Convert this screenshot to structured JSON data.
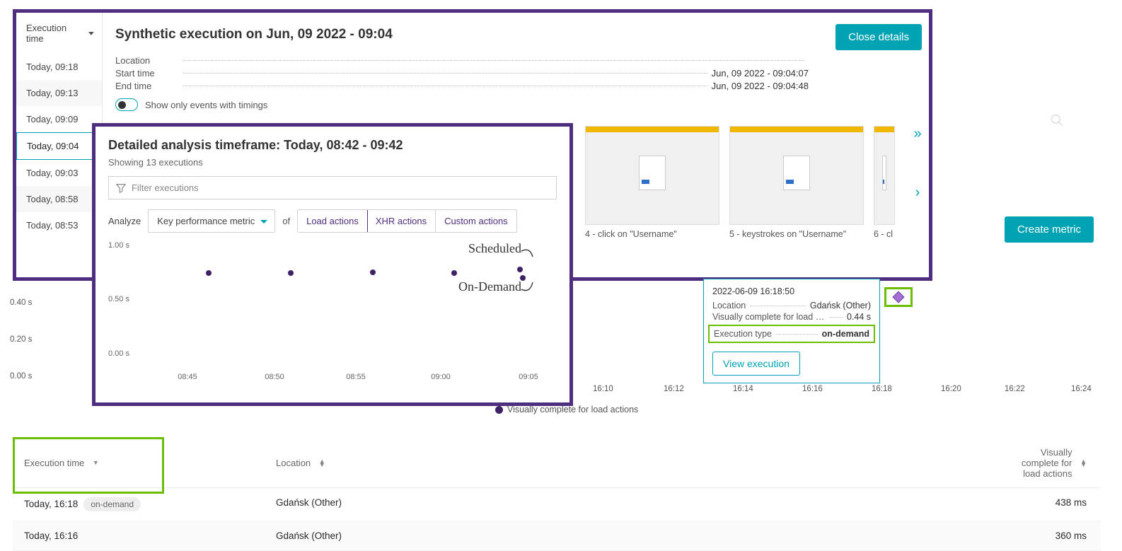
{
  "details": {
    "title": "Synthetic execution on Jun, 09 2022 - 09:04",
    "close_label": "Close details",
    "sidebar_header": "Execution time",
    "times": [
      "Today, 09:18",
      "Today, 09:13",
      "Today, 09:09",
      "Today, 09:04",
      "Today, 09:03",
      "Today, 08:58",
      "Today, 08:53"
    ],
    "selected_index": 3,
    "meta": {
      "location_label": "Location",
      "start_label": "Start time",
      "start_val": "Jun, 09 2022 - 09:04:07",
      "end_label": "End time",
      "end_val": "Jun, 09 2022 - 09:04:48"
    },
    "toggle_label": "Show only events with timings"
  },
  "thumbs": [
    {
      "caption": "4 - click on \"Username\""
    },
    {
      "caption": "5 - keystrokes on \"Username\""
    },
    {
      "caption": "6 - cl"
    }
  ],
  "analysis": {
    "title": "Detailed analysis timeframe: Today, 08:42 - 09:42",
    "subtitle": "Showing 13 executions",
    "filter_placeholder": "Filter executions",
    "analyze_label": "Analyze",
    "metric_selected": "Key performance metric",
    "of_label": "of",
    "segments": [
      "Load actions",
      "XHR actions",
      "Custom actions"
    ],
    "segment_active_index": 0,
    "annotations": {
      "scheduled": "Scheduled",
      "ondemand": "On-Demand"
    }
  },
  "chart_data": {
    "type": "scatter",
    "xlabel": "",
    "ylabel": "",
    "ylim": [
      0,
      1.0
    ],
    "y_ticks": [
      "1.00 s",
      "0.50 s",
      "0.00 s"
    ],
    "x_ticks": [
      "08:45",
      "08:50",
      "08:55",
      "09:00",
      "09:05"
    ],
    "series": [
      {
        "name": "executions",
        "points": [
          {
            "x": "08:46",
            "y": 0.76
          },
          {
            "x": "08:51",
            "y": 0.76
          },
          {
            "x": "08:56",
            "y": 0.77
          },
          {
            "x": "09:01",
            "y": 0.76
          },
          {
            "x": "09:05",
            "y": 0.79,
            "tag": "scheduled"
          },
          {
            "x": "09:05.2",
            "y": 0.72,
            "tag": "ondemand"
          }
        ]
      }
    ]
  },
  "tooltip": {
    "timestamp": "2022-06-09 16:18:50",
    "loc_label": "Location",
    "loc_val": "Gdańsk (Other)",
    "vc_label": "Visually complete for load actions",
    "vc_val": "0.44 s",
    "exec_label": "Execution type",
    "exec_val": "on-demand",
    "view_label": "View execution"
  },
  "bg_chart": {
    "y_ticks": [
      "0.40 s",
      "0.20 s",
      "0.00 s"
    ],
    "x_ticks": [
      "16:10",
      "16:12",
      "16:14",
      "16:16",
      "16:18",
      "16:20",
      "16:22",
      "16:24"
    ],
    "legend": "Visually complete for load actions"
  },
  "create_metric_label": "Create metric",
  "table": {
    "headers": {
      "exec": "Execution time",
      "loc": "Location",
      "vc": "Visually complete for load actions"
    },
    "rows": [
      {
        "time": "Today, 16:18",
        "badge": "on-demand",
        "loc": "Gdańsk (Other)",
        "vc": "438 ms"
      },
      {
        "time": "Today, 16:16",
        "badge": "",
        "loc": "Gdańsk (Other)",
        "vc": "360 ms"
      }
    ]
  }
}
